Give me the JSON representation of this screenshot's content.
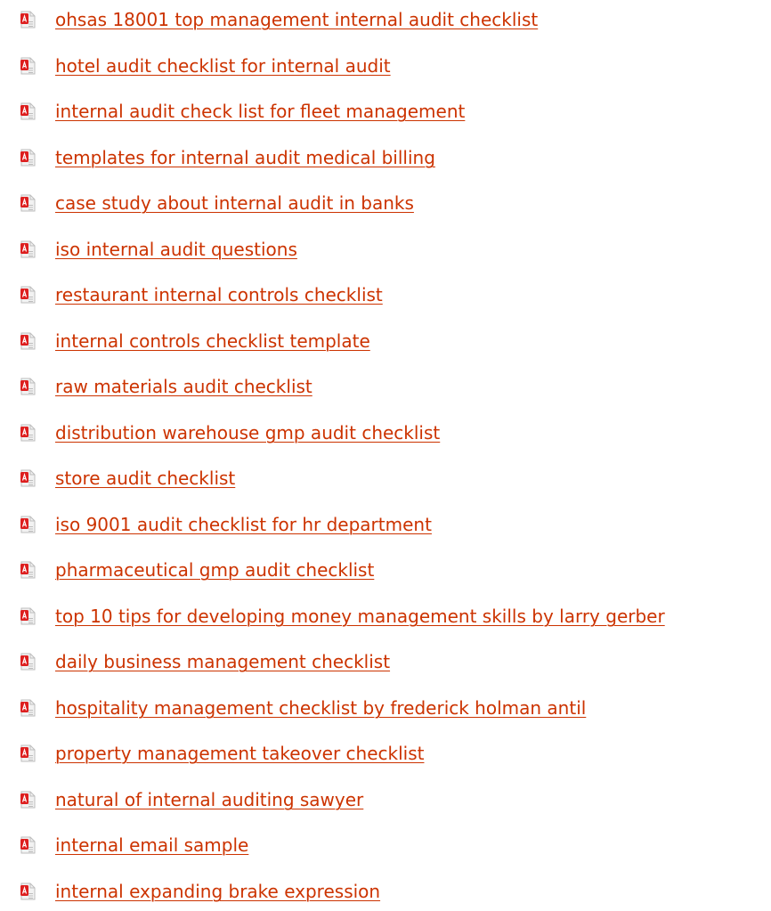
{
  "colors": {
    "link": "#cc3300",
    "icon_red": "#dd1f1f",
    "icon_gray": "#bdbdbd",
    "background": "#ffffff"
  },
  "icon": "pdf-file-icon",
  "links": [
    {
      "label": "ohsas 18001 top management internal audit checklist"
    },
    {
      "label": "hotel audit checklist for internal audit"
    },
    {
      "label": "internal audit check list for fleet management"
    },
    {
      "label": "templates for internal audit medical billing"
    },
    {
      "label": "case study about internal audit in banks"
    },
    {
      "label": "iso internal audit questions"
    },
    {
      "label": "restaurant internal controls checklist"
    },
    {
      "label": "internal controls checklist template"
    },
    {
      "label": "raw materials audit checklist"
    },
    {
      "label": "distribution warehouse gmp audit checklist"
    },
    {
      "label": "store audit checklist"
    },
    {
      "label": "iso 9001 audit checklist for hr department"
    },
    {
      "label": "pharmaceutical gmp audit checklist"
    },
    {
      "label": "top 10 tips for developing money management skills by larry gerber"
    },
    {
      "label": "daily business management checklist"
    },
    {
      "label": "hospitality management checklist by frederick holman antil"
    },
    {
      "label": "property management takeover checklist"
    },
    {
      "label": "natural of internal auditing sawyer"
    },
    {
      "label": "internal email sample"
    },
    {
      "label": "internal expanding brake expression"
    }
  ]
}
